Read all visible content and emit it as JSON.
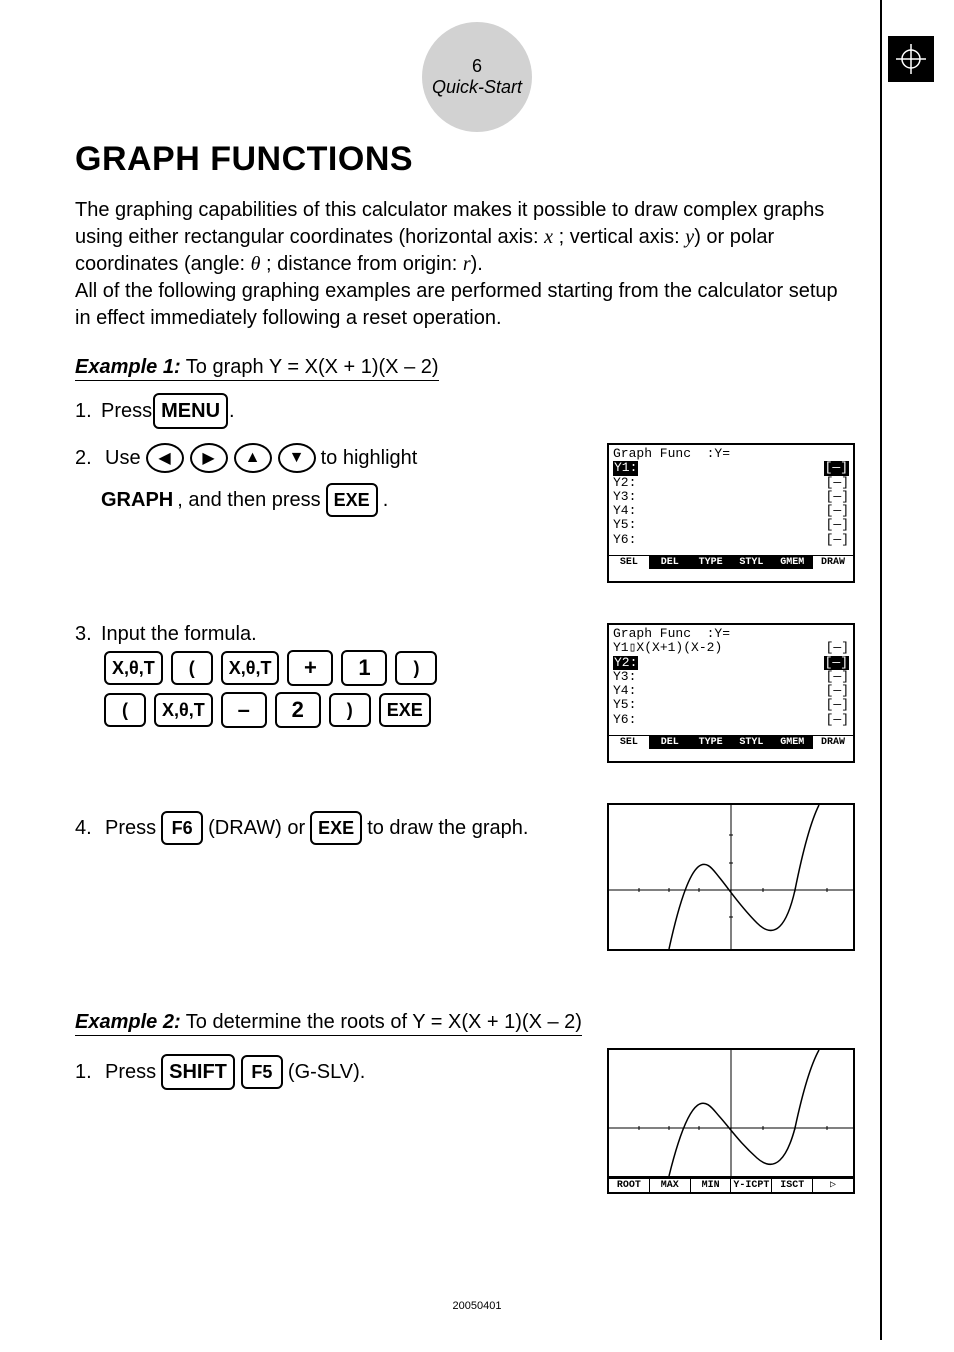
{
  "header": {
    "page_number": "6",
    "section": "Quick-Start"
  },
  "title": "GRAPH FUNCTIONS",
  "intro_p1a": "The graphing capabilities of this calculator makes it possible to draw complex graphs using either rectangular coordinates (horizontal axis: ",
  "intro_x": "x",
  "intro_p1b": " ; vertical axis: ",
  "intro_y": "y",
  "intro_p1c": ") or polar coordinates (angle: ",
  "intro_theta": "θ",
  "intro_p1d": " ; distance from origin: ",
  "intro_r": "r",
  "intro_p1e": ").",
  "intro_p2": "All of the following graphing examples are performed starting from the calculator setup in effect immediately following a reset operation.",
  "example1": {
    "label": "Example 1:",
    "text": "  To graph Y = X(X + 1)(X – 2)"
  },
  "steps1": {
    "s1_num": "1.",
    "s1_a": "Press ",
    "s1_key": "MENU",
    "s1_b": " .",
    "s2_num": "2.",
    "s2_a": "Use ",
    "s2_b": " to highlight",
    "s2_c": "GRAPH",
    "s2_d": ", and then press ",
    "s2_key": "EXE",
    "s2_e": " .",
    "s3_num": "3.",
    "s3_a": "Input the formula.",
    "s4_num": "4.",
    "s4_a": "Press ",
    "s4_key1": "F6",
    "s4_b": " (DRAW) or ",
    "s4_key2": "EXE",
    "s4_c": " to draw the graph."
  },
  "keys_row1": [
    "X,θ,T",
    "(",
    "X,θ,T",
    "+",
    "1",
    ")"
  ],
  "keys_row2": [
    "(",
    "X,θ,T",
    "–",
    "2",
    ")",
    "EXE"
  ],
  "screen1": {
    "title": "Graph Func  :Y=",
    "rows": [
      "Y1:",
      "Y2:",
      "Y3:",
      "Y4:",
      "Y5:",
      "Y6:"
    ],
    "brk": "[—]",
    "softkeys": [
      "SEL",
      "DEL",
      "TYPE",
      "STYL",
      "GMEM",
      "DRAW"
    ]
  },
  "screen2": {
    "title": "Graph Func  :Y=",
    "y1": "Y1▯X(X+1)(X-2)",
    "rows": [
      "Y2:",
      "Y3:",
      "Y4:",
      "Y5:",
      "Y6:"
    ],
    "brk": "[—]",
    "softkeys": [
      "SEL",
      "DEL",
      "TYPE",
      "STYL",
      "GMEM",
      "DRAW"
    ]
  },
  "example2": {
    "label": "Example 2:",
    "text": "  To determine the roots of Y = X(X + 1)(X – 2)"
  },
  "steps2": {
    "s1_num": "1.",
    "s1_a": "Press ",
    "s1_key1": "SHIFT",
    "s1_key2": "F5",
    "s1_b": " (G-SLV)."
  },
  "screen4_softkeys": [
    "ROOT",
    "MAX",
    "MIN",
    "Y-ICPT",
    "ISCT",
    "▷"
  ],
  "footer": "20050401",
  "cursor_glyphs": {
    "left": "◀",
    "right": "▶",
    "up": "▲",
    "down": "▼"
  }
}
